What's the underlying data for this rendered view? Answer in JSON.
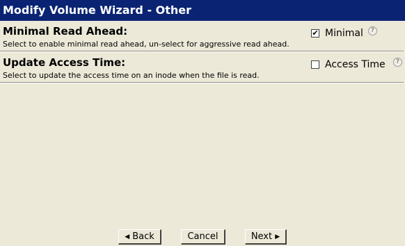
{
  "window": {
    "title": "Modify Volume Wizard - Other"
  },
  "sections": [
    {
      "title": "Minimal Read Ahead:",
      "description": "Select to enable minimal read ahead, un-select for aggressive read ahead.",
      "option_label": "Minimal",
      "checked": true,
      "check_mark": "✔",
      "help_symbol": "?"
    },
    {
      "title": "Update Access Time:",
      "description": "Select to update the access time on an inode when the file is read.",
      "option_label": "Access Time",
      "checked": false,
      "check_mark": "",
      "help_symbol": "?"
    }
  ],
  "buttons": {
    "back_label": "Back",
    "back_arrow": "◀",
    "cancel_label": "Cancel",
    "next_label": "Next",
    "next_arrow": "▶"
  }
}
